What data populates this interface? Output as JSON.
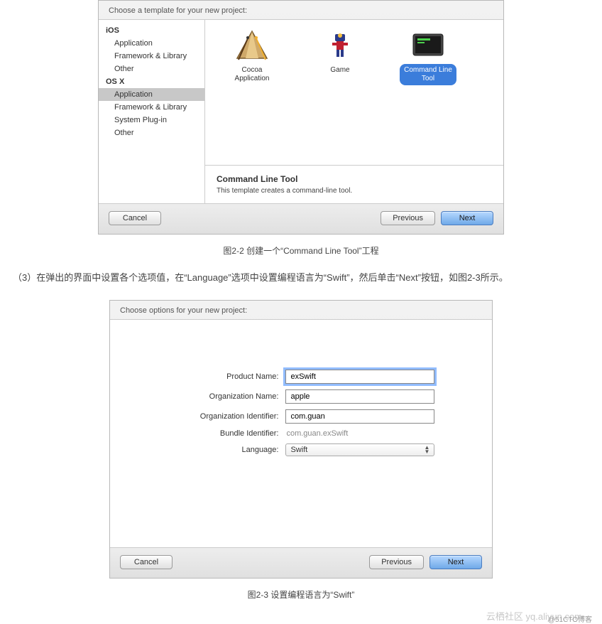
{
  "dialog1": {
    "header": "Choose a template for your new project:",
    "sidebar": {
      "groups": [
        {
          "title": "iOS",
          "items": [
            "Application",
            "Framework & Library",
            "Other"
          ]
        },
        {
          "title": "OS X",
          "items": [
            "Application",
            "Framework & Library",
            "System Plug-in",
            "Other"
          ]
        }
      ],
      "selected": "Application"
    },
    "templates": [
      {
        "name": "Cocoa\nApplication",
        "id": "cocoa-application"
      },
      {
        "name": "Game",
        "id": "game"
      },
      {
        "name": "Command Line\nTool",
        "id": "command-line-tool",
        "selected": true
      }
    ],
    "description": {
      "title": "Command Line Tool",
      "text": "This template creates a command-line tool."
    },
    "buttons": {
      "cancel": "Cancel",
      "previous": "Previous",
      "next": "Next"
    }
  },
  "caption1": "图2-2 创建一个“Command Line Tool”工程",
  "body_text": "（3）在弹出的界面中设置各个选项值，在“Language”选项中设置编程语言为“Swift”，然后单击“Next”按钮，如图2-3所示。",
  "dialog2": {
    "header": "Choose options for your new project:",
    "fields": {
      "product_name": {
        "label": "Product Name:",
        "value": "exSwift"
      },
      "organization_name": {
        "label": "Organization Name:",
        "value": "apple"
      },
      "organization_identifier": {
        "label": "Organization Identifier:",
        "value": "com.guan"
      },
      "bundle_identifier": {
        "label": "Bundle Identifier:",
        "value": "com.guan.exSwift"
      },
      "language": {
        "label": "Language:",
        "value": "Swift"
      }
    },
    "buttons": {
      "cancel": "Cancel",
      "previous": "Previous",
      "next": "Next"
    }
  },
  "caption2": "图2-3 设置编程语言为“Swift”",
  "watermark": "云栖社区 yq.aliyun.com",
  "watermark2": "@51CTO博客"
}
